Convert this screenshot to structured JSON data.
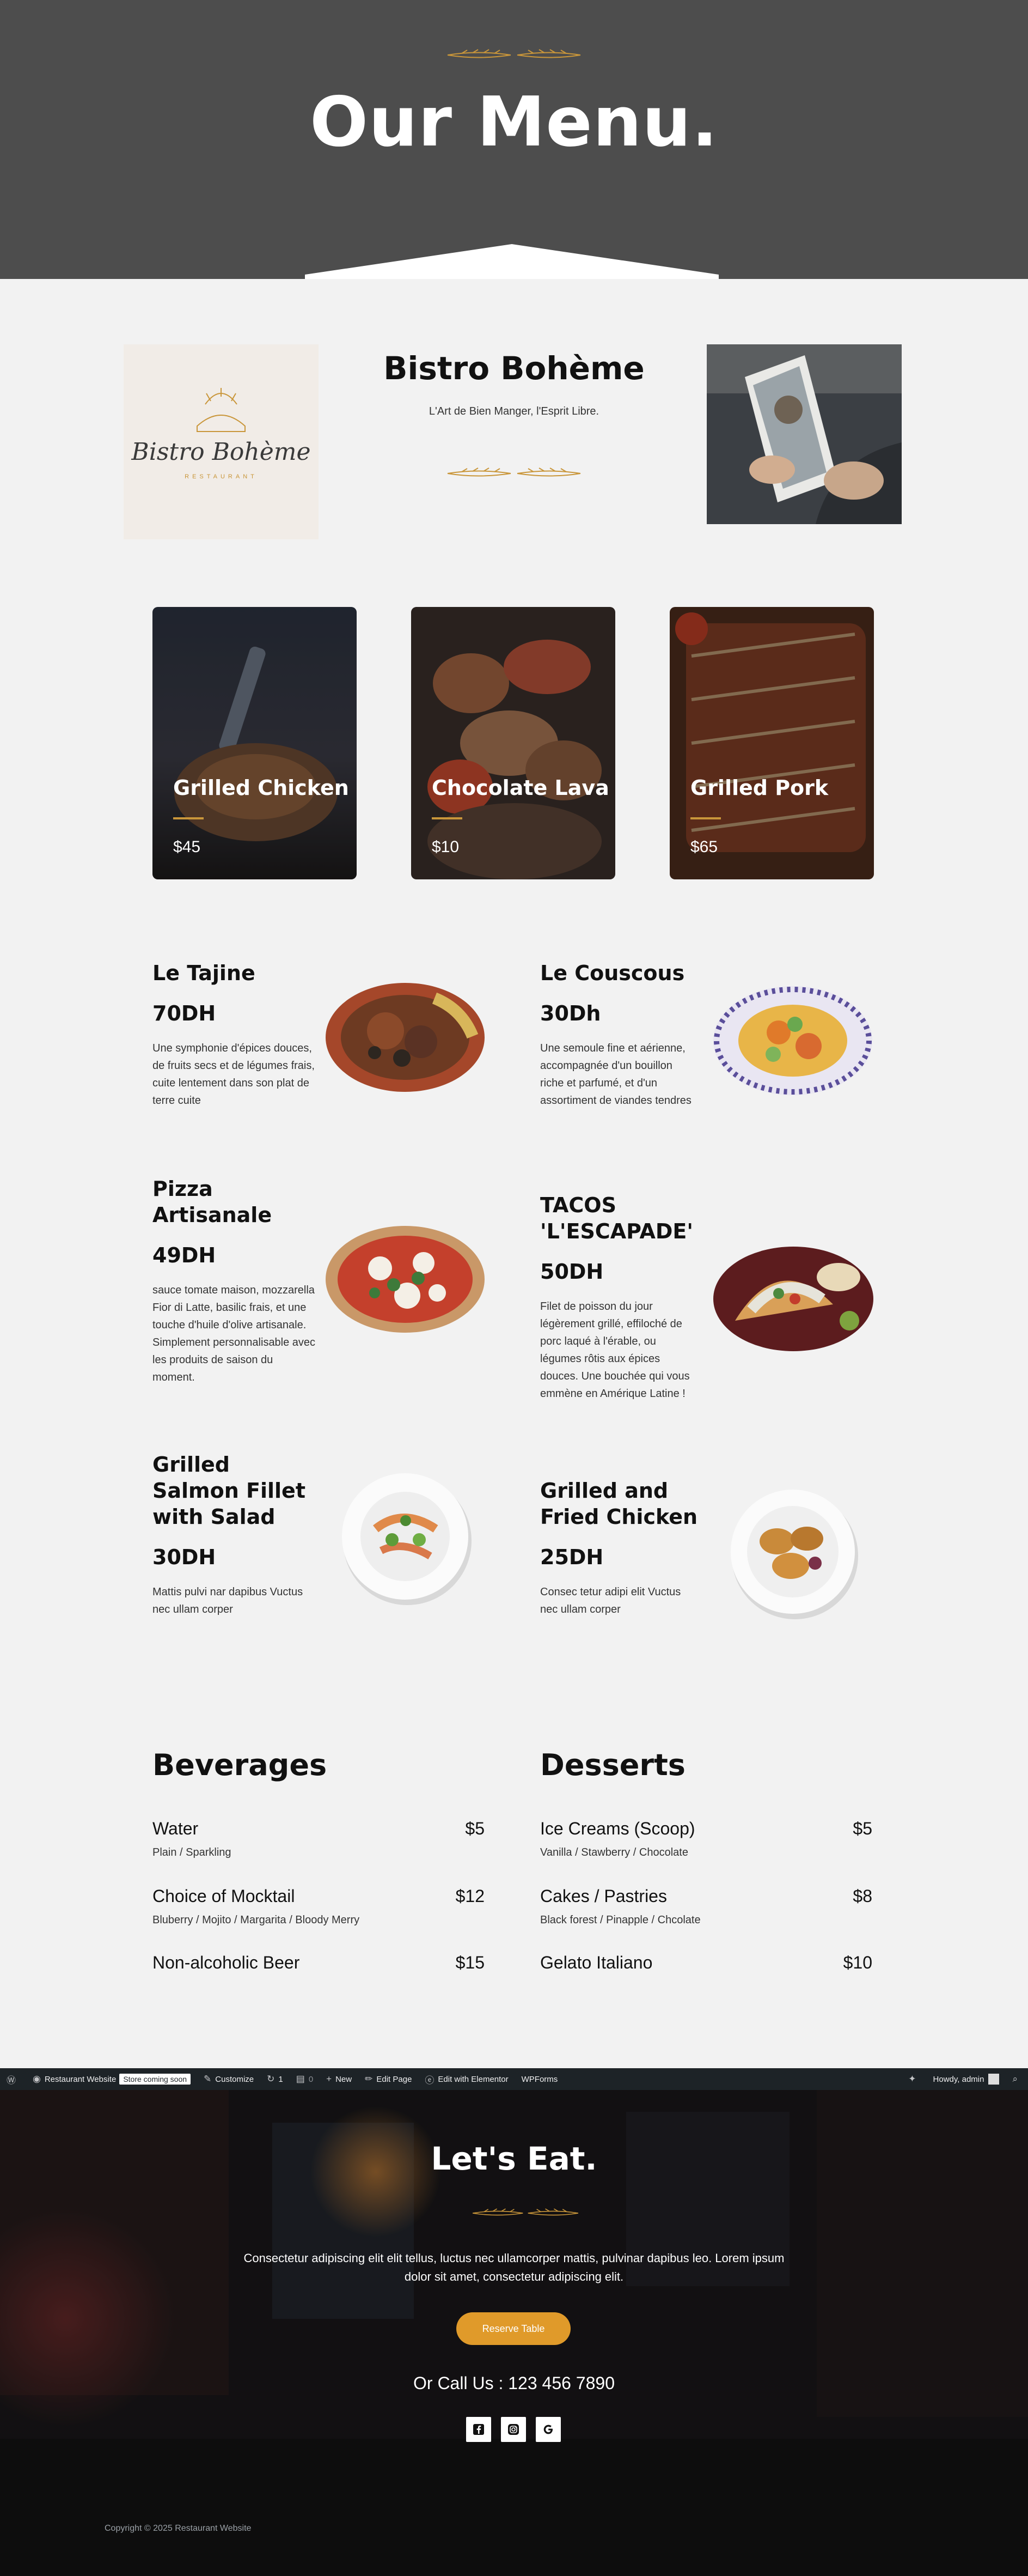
{
  "hero": {
    "title": "Our Menu."
  },
  "intro": {
    "title": "Bistro Bohème",
    "tagline": "L'Art de Bien Manger, l'Esprit Libre.",
    "logo_script": "Bistro Bohème",
    "logo_sub": "RESTAURANT"
  },
  "featured": [
    {
      "name": "Grilled Chicken",
      "price": "$45"
    },
    {
      "name": "Chocolate Lava",
      "price": "$10"
    },
    {
      "name": "Grilled Pork",
      "price": "$65"
    }
  ],
  "menu_items": [
    {
      "name": "Le Tajine",
      "price": "70DH",
      "desc": "Une symphonie d'épices douces, de fruits secs et de légumes frais, cuite lentement dans son plat de terre cuite"
    },
    {
      "name": "Le Couscous",
      "price": "30Dh",
      "desc": "Une semoule fine et aérienne, accompagnée d'un bouillon riche et parfumé, et d'un assortiment de viandes tendres"
    },
    {
      "name": "Pizza Artisanale",
      "price": "49DH",
      "desc": "sauce tomate maison, mozzarella Fior di Latte, basilic frais, et une touche d'huile d'olive artisanale. Simplement personnalisable avec les produits de saison du moment."
    },
    {
      "name": "TACOS 'L'ESCAPADE'",
      "price": "50DH",
      "desc": "Filet de poisson du jour légèrement grillé, effiloché de porc laqué à l'érable, ou légumes rôtis aux épices douces. Une bouchée qui vous emmène en Amérique Latine !"
    },
    {
      "name": "Grilled Salmon Fillet with Salad",
      "price": "30DH",
      "desc": "Mattis pulvi nar dapibus Vuctus nec ullam corper"
    },
    {
      "name": "Grilled and Fried Chicken",
      "price": "25DH",
      "desc": "Consec tetur adipi elit Vuctus nec ullam corper"
    }
  ],
  "beverages": {
    "title": "Beverages",
    "items": [
      {
        "name": "Water",
        "price": "$5",
        "sub": "Plain / Sparkling"
      },
      {
        "name": "Choice of Mocktail",
        "price": "$12",
        "sub": "Bluberry / Mojito / Margarita / Bloody Merry"
      },
      {
        "name": "Non-alcoholic Beer",
        "price": "$15",
        "sub": ""
      }
    ]
  },
  "desserts": {
    "title": "Desserts",
    "items": [
      {
        "name": "Ice Creams (Scoop)",
        "price": "$5",
        "sub": "Vanilla / Stawberry  / Chocolate"
      },
      {
        "name": "Cakes / Pastries",
        "price": "$8",
        "sub": "Black forest / Pinapple / Chcolate"
      },
      {
        "name": "Gelato Italiano",
        "price": "$10",
        "sub": ""
      }
    ]
  },
  "adminbar": {
    "site": "Restaurant Website",
    "badge": "Store coming soon",
    "customize": "Customize",
    "updates": "1",
    "comments": "0",
    "new": "New",
    "edit_page": "Edit Page",
    "elementor": "Edit with Elementor",
    "wpforms": "WPForms",
    "howdy": "Howdy, admin"
  },
  "footer": {
    "title": "Let's Eat.",
    "text": "Consectetur adipiscing elit elit tellus, luctus nec ullamcorper mattis, pulvinar dapibus leo. Lorem ipsum dolor sit amet, consectetur adipiscing elit.",
    "button": "Reserve Table",
    "call": "Or Call Us : 123 456 7890",
    "copyright": "Copyright © 2025 Restaurant Website"
  },
  "colors": {
    "accent": "#c9963a",
    "button": "#e09a2a",
    "hero_bg": "#4d4d4d",
    "page_bg": "#f2f2f2",
    "adminbar_bg": "#1d2327"
  },
  "icons": [
    "wordpress-icon",
    "dashboard-icon",
    "brush-icon",
    "refresh-icon",
    "comment-icon",
    "plus-icon",
    "pencil-icon",
    "elementor-icon",
    "sparkle-icon",
    "search-icon",
    "facebook-icon",
    "instagram-icon",
    "google-icon"
  ]
}
